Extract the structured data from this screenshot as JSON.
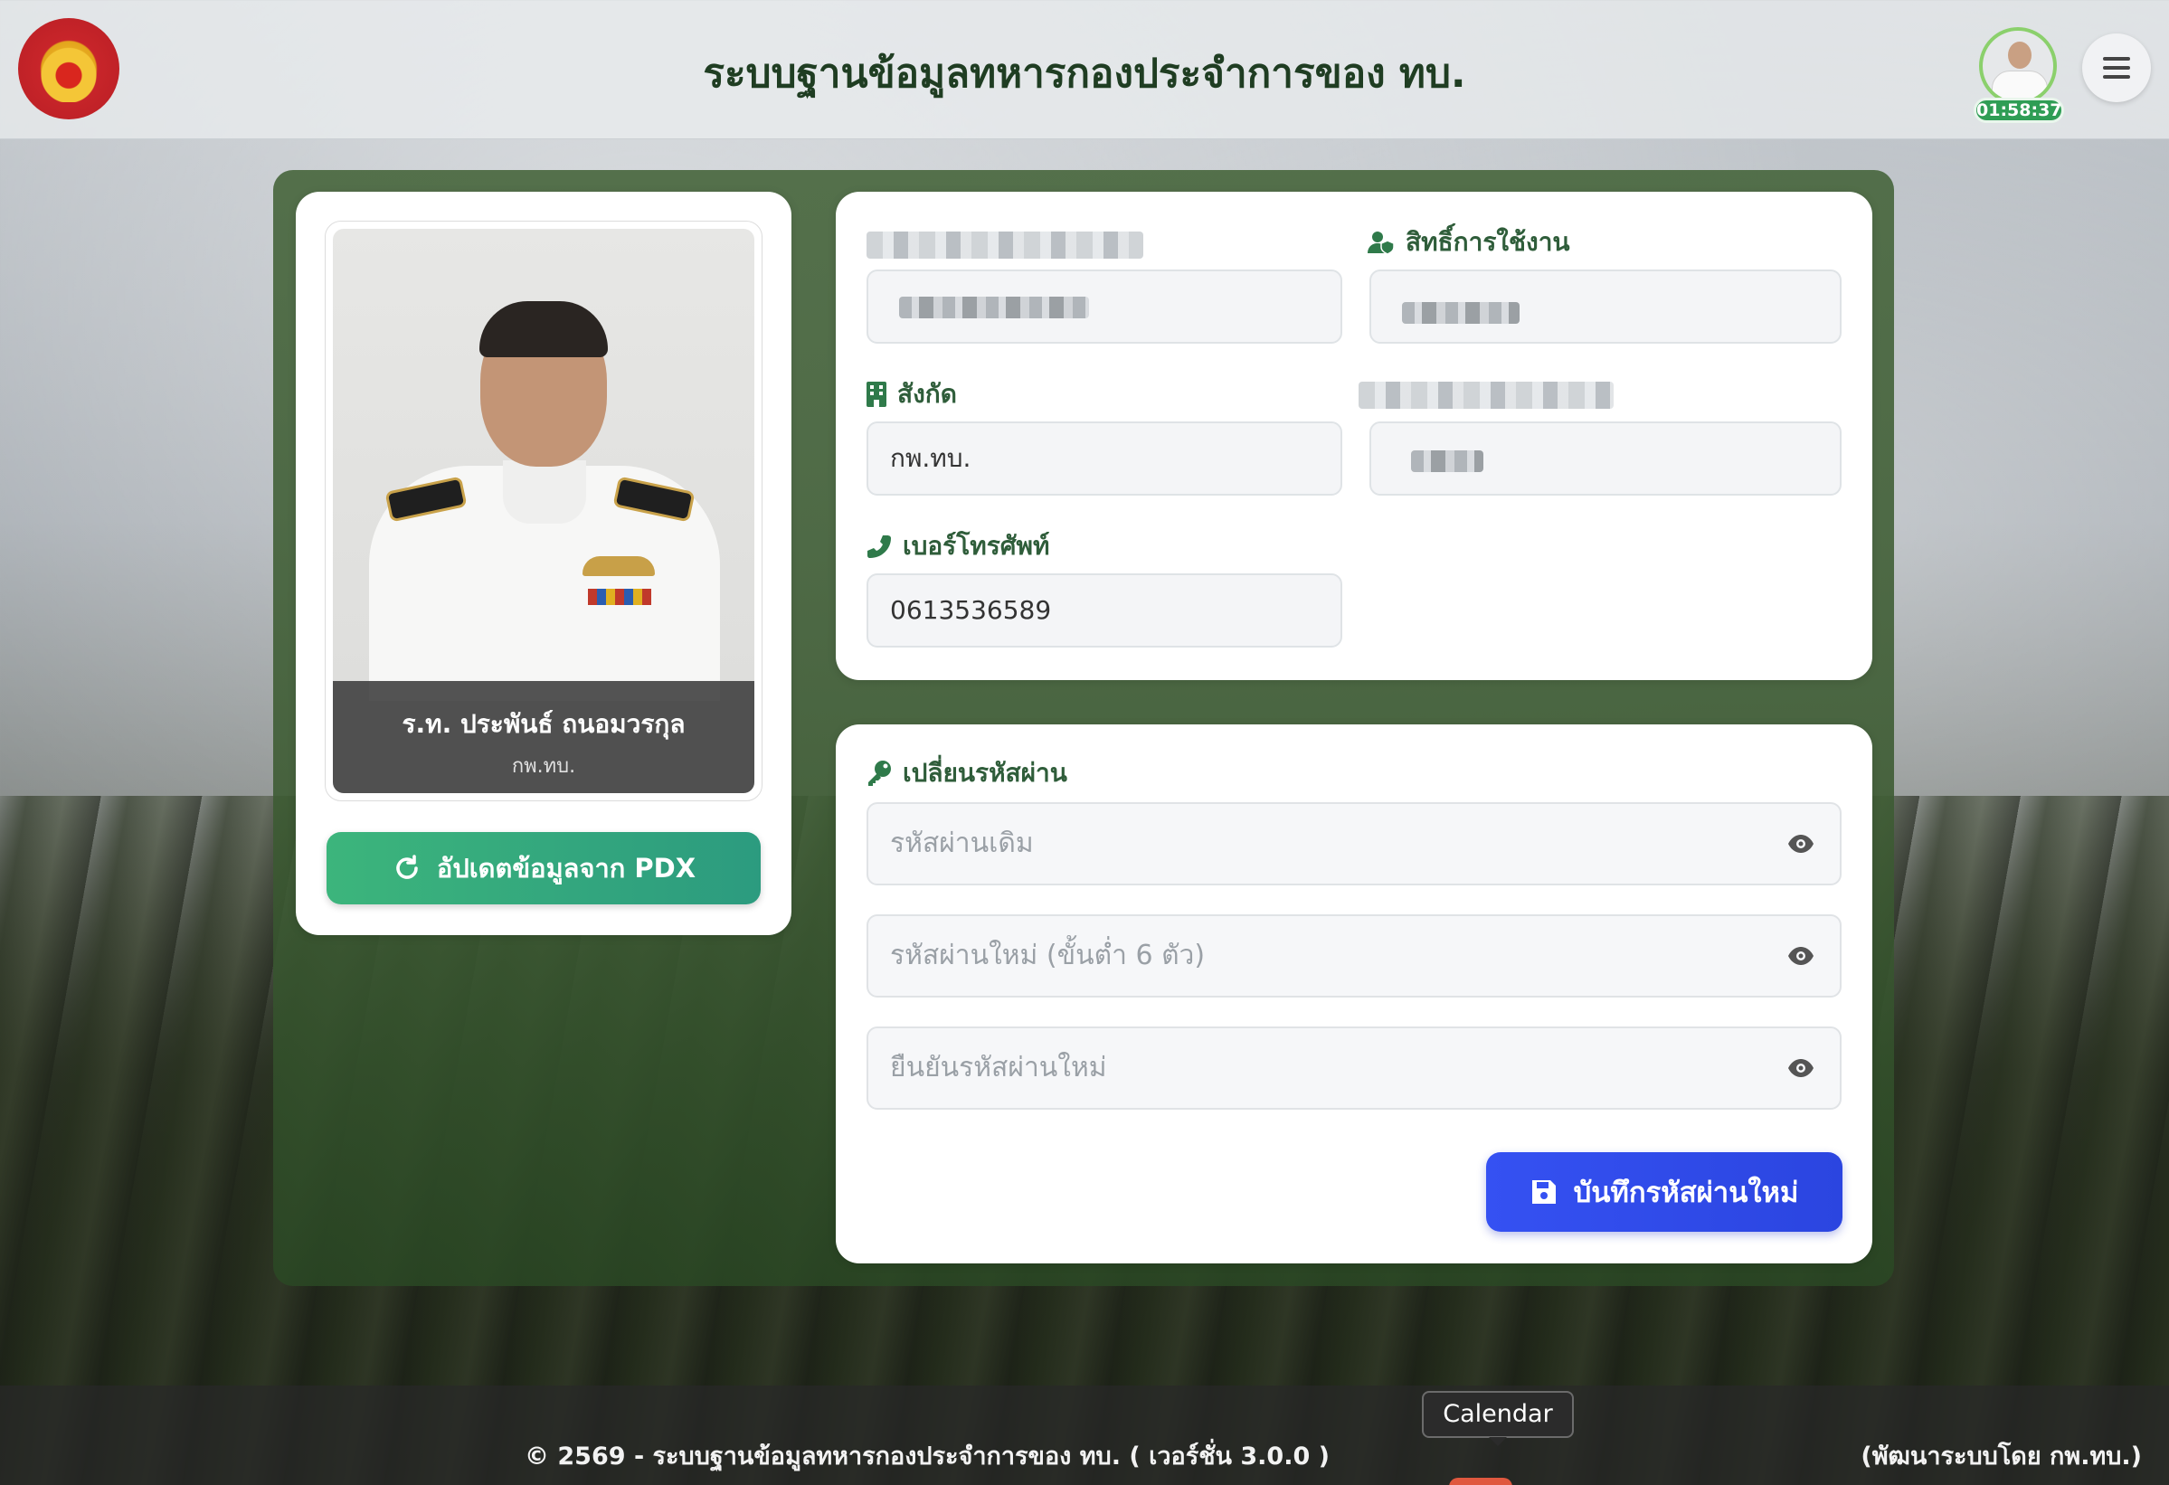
{
  "header": {
    "title": "ระบบฐานข้อมูลทหารกองประจำการของ ทบ.",
    "timer": "01:58:37"
  },
  "profile": {
    "name": "ร.ท. ประพันธ์ ถนอมวรกุล",
    "unit": "กพ.ทบ.",
    "update_button": "อัปเดตข้อมูลจาก PDX"
  },
  "info": {
    "role_label": "สิทธิ์การใช้งาน",
    "affiliation_label": "สังกัด",
    "affiliation_value": "กพ.ทบ.",
    "phone_label": "เบอร์โทรศัพท์",
    "phone_value": "0613536589"
  },
  "password": {
    "section_title": "เปลี่ยนรหัสผ่าน",
    "old_placeholder": "รหัสผ่านเดิม",
    "new_placeholder": "รหัสผ่านใหม่ (ขั้นต่ำ 6 ตัว)",
    "confirm_placeholder": "ยืนยันรหัสผ่านใหม่",
    "save_button": "บันทึกรหัสผ่านใหม่"
  },
  "footer": {
    "copyright": "© 2569 - ระบบฐานข้อมูลทหารกองประจำการของ ทบ.   ( เวอร์ชั่น 3.0.0 )",
    "developer": "(พัฒนาระบบโดย กพ.ทบ.)"
  },
  "tooltip": {
    "text": "Calendar"
  },
  "colors": {
    "accent_green": "#2f9d55",
    "save_blue": "#3551f2",
    "title_green": "#1f3d22"
  }
}
